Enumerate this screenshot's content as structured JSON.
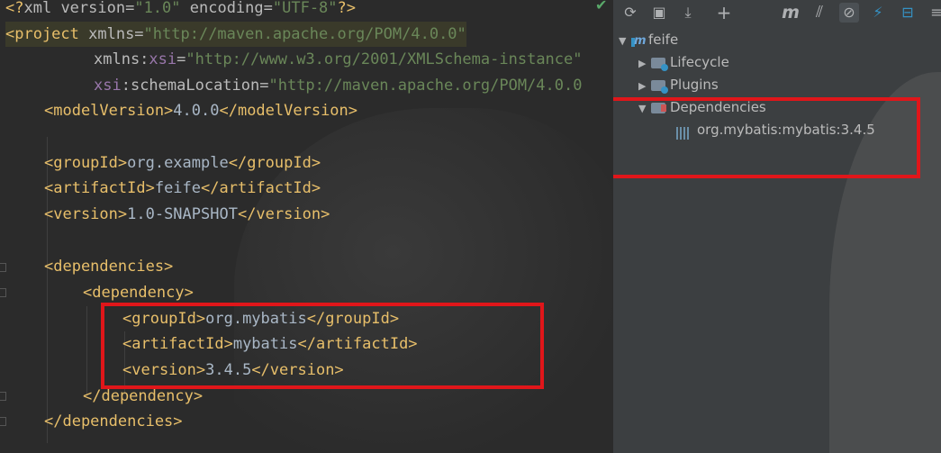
{
  "editor": {
    "lines": {
      "l1": {
        "decl_open": "<?",
        "decl_name": "xml",
        "decl_attrs": " version=",
        "decl_v1": "\"1.0\"",
        "decl_attrs2": " encoding=",
        "decl_v2": "\"UTF-8\"",
        "decl_close": "?>"
      },
      "l2": {
        "tag": "<project",
        "attr": " xmlns=",
        "val": "\"http://maven.apache.org/POM/4.0.0\""
      },
      "l3": {
        "attr": "xmlns:",
        "ns": "xsi",
        "eq": "=",
        "val": "\"http://www.w3.org/2001/XMLSchema-instance\""
      },
      "l4": {
        "ns": "xsi",
        "attr": ":schemaLocation=",
        "val": "\"http://maven.apache.org/POM/4.0.0"
      },
      "l5": {
        "open": "<modelVersion>",
        "text": "4.0.0",
        "close": "</modelVersion>"
      },
      "l7": {
        "open": "<groupId>",
        "text": "org.example",
        "close": "</groupId>"
      },
      "l8": {
        "open": "<artifactId>",
        "text": "feife",
        "close": "</artifactId>"
      },
      "l9": {
        "open": "<version>",
        "text": "1.0-SNAPSHOT",
        "close": "</version>"
      },
      "l11": {
        "open": "<dependencies>"
      },
      "l12": {
        "open": "<dependency>"
      },
      "l13": {
        "open": "<groupId>",
        "text": "org.mybatis",
        "close": "</groupId>"
      },
      "l14": {
        "open": "<artifactId>",
        "text": "mybatis",
        "close": "</artifactId>"
      },
      "l15": {
        "open": "<version>",
        "text": "3.4.5",
        "close": "</version>"
      },
      "l16": {
        "close": "</dependency>"
      },
      "l17": {
        "close": "</dependencies>"
      }
    }
  },
  "maven_panel": {
    "toolbar": {
      "refresh": "⟳",
      "add_project": "+",
      "download": "⤓",
      "add": "+",
      "maven_goal": "m",
      "toggle_offline": "⫽",
      "skip_tests": "⚡",
      "collapse": "⊟",
      "settings": "⚙"
    },
    "tree": {
      "project": "feife",
      "lifecycle": "Lifecycle",
      "plugins": "Plugins",
      "dependencies": "Dependencies",
      "dependency_item": "org.mybatis:mybatis:3.4.5"
    }
  },
  "colors": {
    "highlight_box": "#e0161a",
    "editor_bg": "#2b2b2b",
    "panel_bg": "#3c3f41"
  }
}
